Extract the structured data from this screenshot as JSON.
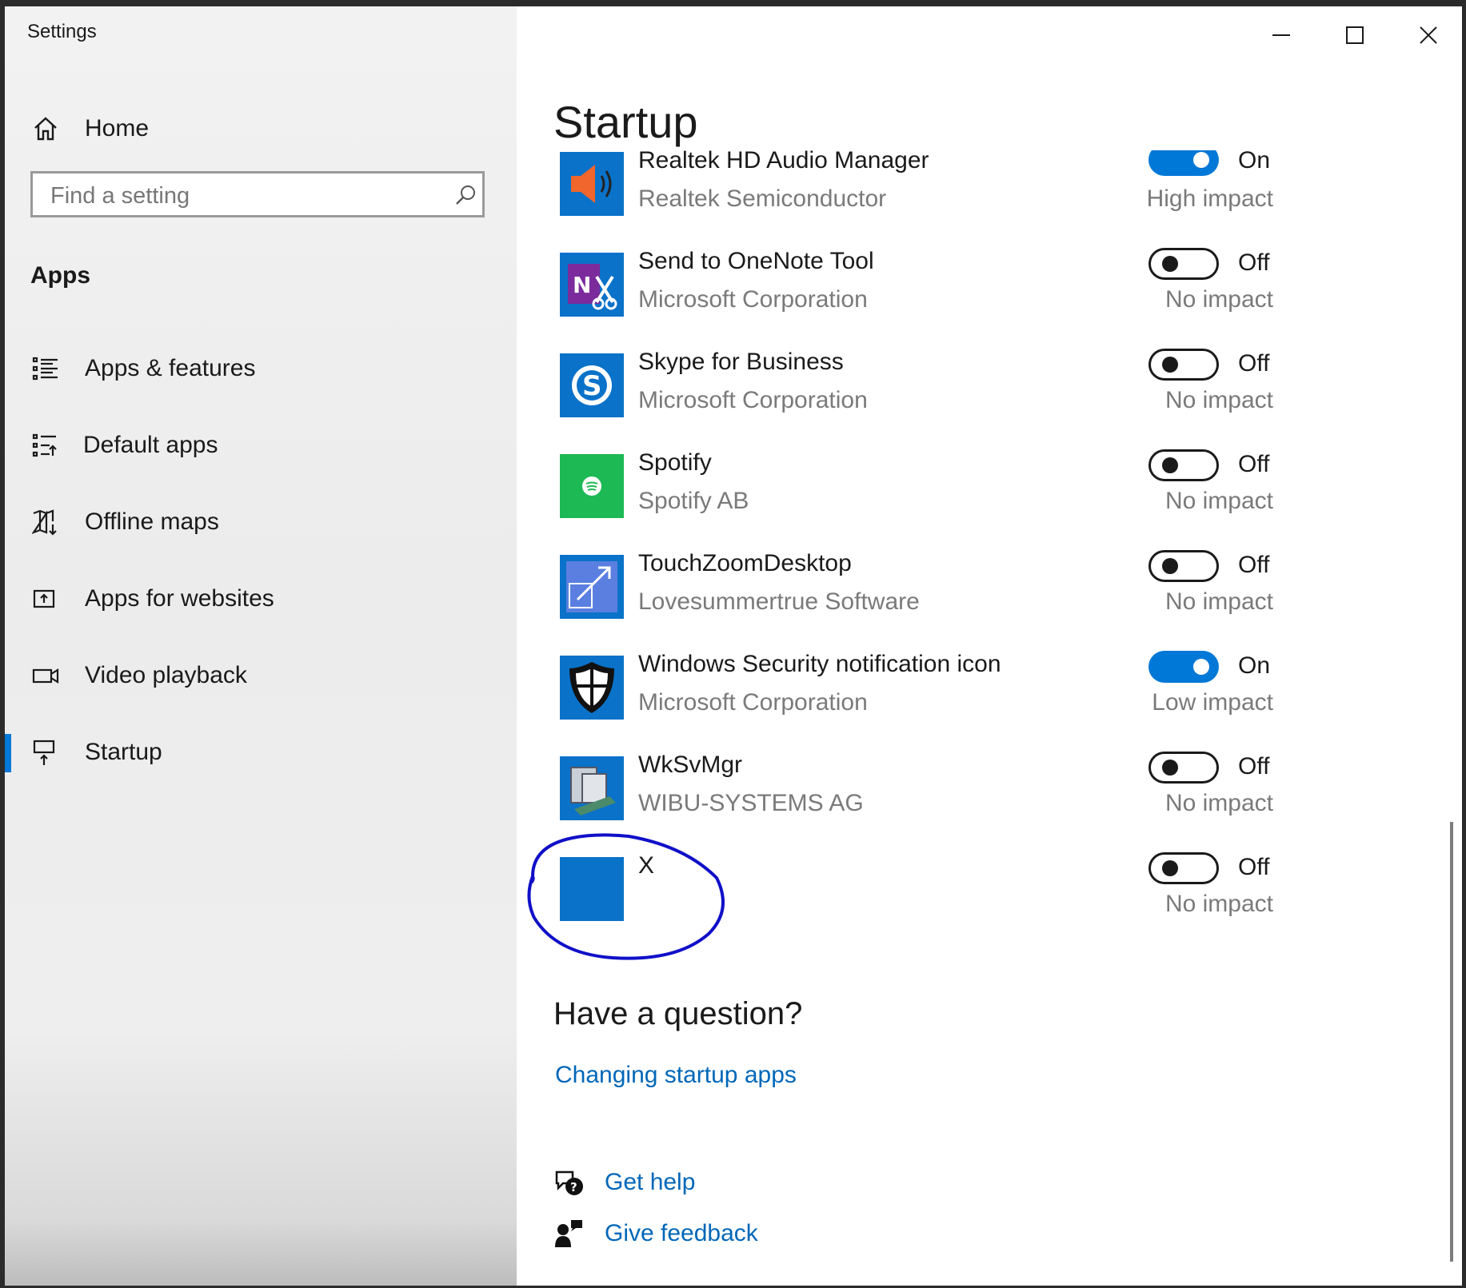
{
  "window": {
    "title": "Settings"
  },
  "sidebar": {
    "home_label": "Home",
    "search_placeholder": "Find a setting",
    "section": "Apps",
    "items": [
      {
        "label": "Apps & features",
        "icon": "apps-list-icon"
      },
      {
        "label": "Default apps",
        "icon": "default-apps-icon"
      },
      {
        "label": "Offline maps",
        "icon": "map-download-icon"
      },
      {
        "label": "Apps for websites",
        "icon": "website-app-icon"
      },
      {
        "label": "Video playback",
        "icon": "video-camera-icon"
      },
      {
        "label": "Startup",
        "icon": "startup-icon",
        "selected": true
      }
    ]
  },
  "main": {
    "title": "Startup",
    "apps": [
      {
        "name": "Realtek HD Audio Manager",
        "publisher": "Realtek Semiconductor",
        "state": "On",
        "impact": "High impact",
        "icon": "speaker-icon"
      },
      {
        "name": "Send to OneNote Tool",
        "publisher": "Microsoft Corporation",
        "state": "Off",
        "impact": "No impact",
        "icon": "onenote-icon"
      },
      {
        "name": "Skype for Business",
        "publisher": "Microsoft Corporation",
        "state": "Off",
        "impact": "No impact",
        "icon": "skype-icon"
      },
      {
        "name": "Spotify",
        "publisher": "Spotify AB",
        "state": "Off",
        "impact": "No impact",
        "icon": "spotify-icon"
      },
      {
        "name": "TouchZoomDesktop",
        "publisher": "Lovesummertrue Software",
        "state": "Off",
        "impact": "No impact",
        "icon": "zoom-arrows-icon"
      },
      {
        "name": "Windows Security notification icon",
        "publisher": "Microsoft Corporation",
        "state": "On",
        "impact": "Low impact",
        "icon": "shield-icon"
      },
      {
        "name": "WkSvMgr",
        "publisher": "WIBU-SYSTEMS AG",
        "state": "Off",
        "impact": "No impact",
        "icon": "computer-icon"
      },
      {
        "name": "X",
        "publisher": "",
        "state": "Off",
        "impact": "No impact",
        "icon": "blank-app-icon"
      }
    ],
    "question_heading": "Have a question?",
    "question_link": "Changing startup apps",
    "get_help": "Get help",
    "give_feedback": "Give feedback"
  },
  "colors": {
    "accent": "#0078d7",
    "link": "#0067b8",
    "annotation": "#1010c8"
  }
}
